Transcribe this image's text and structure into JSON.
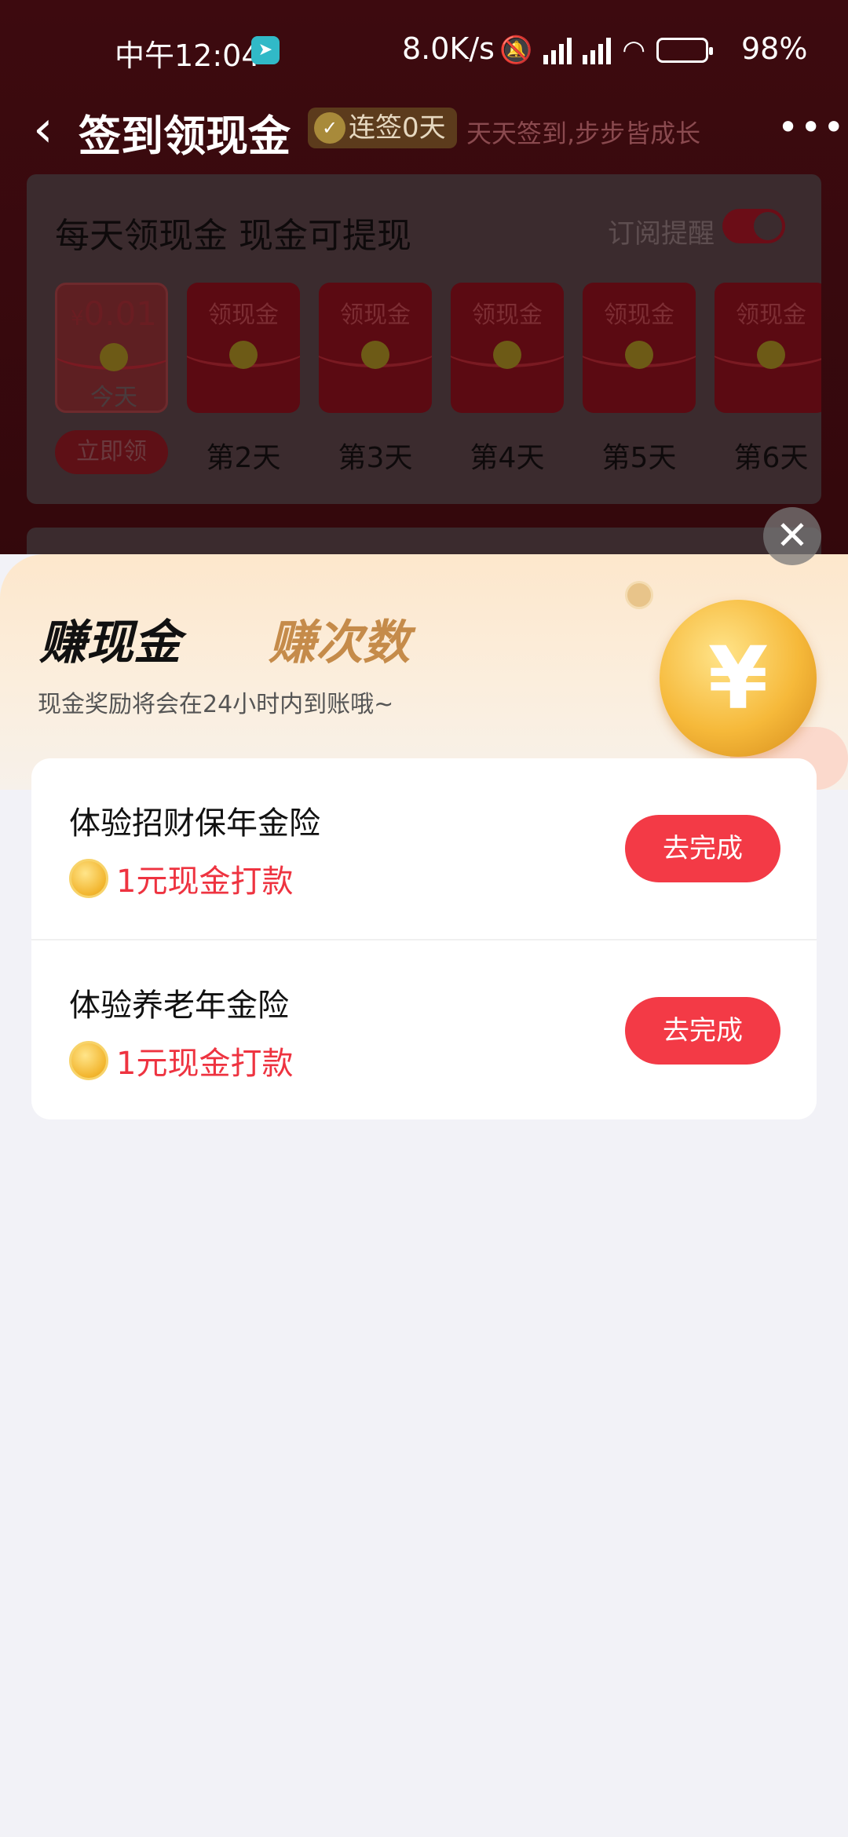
{
  "status_bar": {
    "time": "中午12:04",
    "speed": "8.0K/s",
    "battery": "98%"
  },
  "nav": {
    "back_icon": "chevron-left-icon",
    "title": "签到领现金",
    "streak": "连签0天",
    "slogan": "天天签到,步步皆成长",
    "more_icon": "more-dots-icon"
  },
  "checkin": {
    "heading": "每天领现金 现金可提现",
    "reminder_label": "订阅提醒",
    "reminder_on": true,
    "today_amount": "0.01",
    "today_currency": "¥",
    "today_text": "今天",
    "claim_button": "立即领",
    "envelope_label": "领现金",
    "days": [
      "第2天",
      "第3天",
      "第4天",
      "第5天",
      "第6天"
    ]
  },
  "sheet": {
    "tab_active": "赚现金",
    "tab_inactive": "赚次数",
    "description": "现金奖励将会在24小时内到账哦~",
    "coin_symbol": "¥",
    "close_icon": "close-icon",
    "tasks": [
      {
        "name": "体验招财保年金险",
        "reward": "1元现金打款",
        "button": "去完成"
      },
      {
        "name": "体验养老年金险",
        "reward": "1元现金打款",
        "button": "去完成"
      }
    ]
  },
  "colors": {
    "accent_red": "#f33a46",
    "reward_red": "#ee3340",
    "tab_gold": "#c58b4a"
  }
}
